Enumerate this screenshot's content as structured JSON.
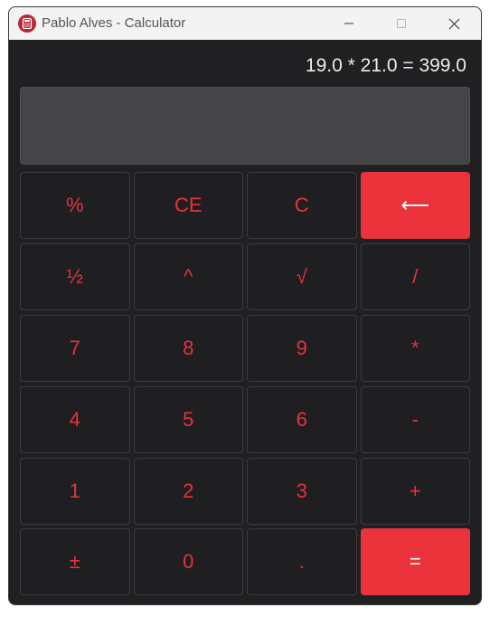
{
  "window": {
    "title": "Pablo Alves - Calculator"
  },
  "display": {
    "expression": "19.0 * 21.0 = 399.0",
    "value": ""
  },
  "keys": [
    {
      "label": "%",
      "name": "percent-button",
      "style": "normal"
    },
    {
      "label": "CE",
      "name": "clear-entry-button",
      "style": "normal"
    },
    {
      "label": "C",
      "name": "clear-button",
      "style": "normal"
    },
    {
      "label": "⟵",
      "name": "backspace-button",
      "style": "accent"
    },
    {
      "label": "½",
      "name": "half-button",
      "style": "normal"
    },
    {
      "label": "^",
      "name": "power-button",
      "style": "normal"
    },
    {
      "label": "√",
      "name": "square-root-button",
      "style": "normal"
    },
    {
      "label": "/",
      "name": "divide-button",
      "style": "normal"
    },
    {
      "label": "7",
      "name": "digit-7-button",
      "style": "normal"
    },
    {
      "label": "8",
      "name": "digit-8-button",
      "style": "normal"
    },
    {
      "label": "9",
      "name": "digit-9-button",
      "style": "normal"
    },
    {
      "label": "*",
      "name": "multiply-button",
      "style": "normal"
    },
    {
      "label": "4",
      "name": "digit-4-button",
      "style": "normal"
    },
    {
      "label": "5",
      "name": "digit-5-button",
      "style": "normal"
    },
    {
      "label": "6",
      "name": "digit-6-button",
      "style": "normal"
    },
    {
      "label": "-",
      "name": "subtract-button",
      "style": "normal"
    },
    {
      "label": "1",
      "name": "digit-1-button",
      "style": "normal"
    },
    {
      "label": "2",
      "name": "digit-2-button",
      "style": "normal"
    },
    {
      "label": "3",
      "name": "digit-3-button",
      "style": "normal"
    },
    {
      "label": "+",
      "name": "add-button",
      "style": "normal"
    },
    {
      "label": "±",
      "name": "plus-minus-button",
      "style": "normal"
    },
    {
      "label": "0",
      "name": "digit-0-button",
      "style": "normal"
    },
    {
      "label": ".",
      "name": "decimal-button",
      "style": "normal"
    },
    {
      "label": "=",
      "name": "equals-button",
      "style": "accent"
    }
  ],
  "icons": {
    "app": "calculator-icon",
    "minimize": "minimize-icon",
    "maximize": "maximize-icon",
    "close": "close-icon"
  },
  "colors": {
    "accent": "#ea333b",
    "key_text": "#e8323c",
    "background": "#202023",
    "display": "#454547"
  }
}
